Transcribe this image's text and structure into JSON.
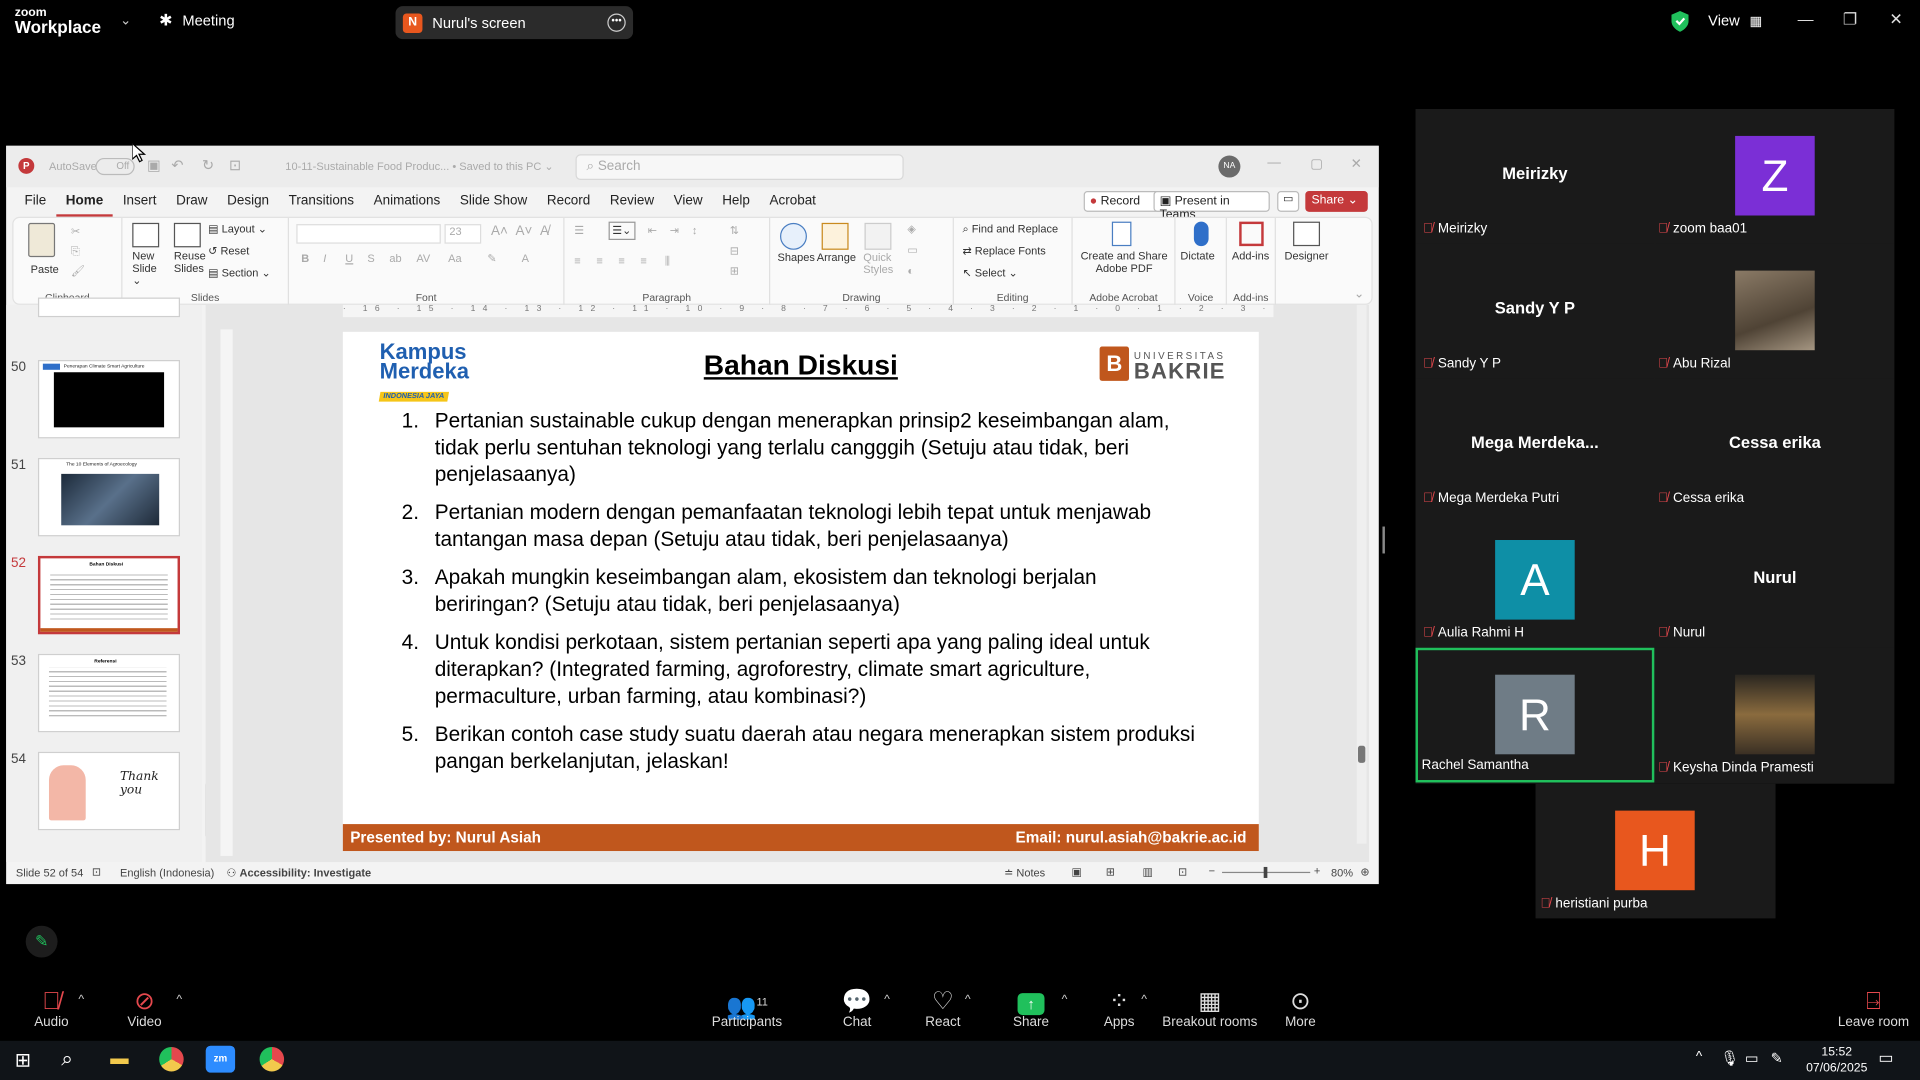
{
  "zoom": {
    "logo_line1": "zoom",
    "logo_line2": "Workplace",
    "meeting_label": "Meeting",
    "share_initial": "N",
    "share_title": "Nurul's screen",
    "view_label": "View"
  },
  "ppt": {
    "autosave": "AutoSave",
    "autosave_state": "Off",
    "filename": "10-11-Sustainable Food Produc... • Saved to this PC ⌄",
    "search_placeholder": "Search",
    "user_initials": "NA",
    "menu": [
      "File",
      "Home",
      "Insert",
      "Draw",
      "Design",
      "Transitions",
      "Animations",
      "Slide Show",
      "Record",
      "Review",
      "View",
      "Help",
      "Acrobat"
    ],
    "record_btn": "Record",
    "present_btn": "Present in Teams",
    "share_btn": "Share",
    "ribbon": {
      "paste": "Paste",
      "clipboard": "Clipboard",
      "new_slide": "New Slide ⌄",
      "reuse_slides": "Reuse Slides",
      "layout": "Layout ⌄",
      "reset": "Reset",
      "section": "Section ⌄",
      "slides": "Slides",
      "font": "Font",
      "font_size": "23",
      "paragraph": "Paragraph",
      "shapes": "Shapes",
      "arrange": "Arrange",
      "quick_styles": "Quick Styles",
      "drawing": "Drawing",
      "find_replace": "Find and Replace",
      "replace_fonts": "Replace Fonts",
      "select": "Select ⌄",
      "editing": "Editing",
      "create_share": "Create and Share Adobe PDF",
      "adobe_acrobat": "Adobe Acrobat",
      "dictate": "Dictate",
      "voice": "Voice",
      "addins": "Add-ins",
      "addins_group": "Add-ins",
      "designer": "Designer"
    },
    "thumb_numbers": [
      "50",
      "51",
      "52",
      "53",
      "54"
    ],
    "thumb_captions": [
      "Penerapan Climate Smart Agriculture",
      "The 10 Elements of Agroecology",
      "Bahan Diskusi",
      "Referensi",
      "Thank you"
    ],
    "status_slide": "Slide 52 of 54",
    "status_lang": "English (Indonesia)",
    "status_access": "Accessibility: Investigate",
    "status_notes": "Notes",
    "status_zoom": "80%"
  },
  "slide": {
    "logo_left_1": "Kampus",
    "logo_left_2": "Merdeka",
    "logo_left_3": "INDONESIA JAYA",
    "title": "Bahan Diskusi",
    "logo_right_1": "UNIVERSITAS",
    "logo_right_2": "BAKRIE",
    "items": [
      {
        "n": "1.",
        "t": "Pertanian sustainable cukup dengan menerapkan prinsip2 keseimbangan alam, tidak perlu sentuhan teknologi yang terlalu cangggih (Setuju atau tidak, beri penjelasaanya)"
      },
      {
        "n": "2.",
        "t": "Pertanian modern dengan pemanfaatan teknologi lebih tepat untuk menjawab tantangan masa depan (Setuju atau tidak, beri penjelasaanya)"
      },
      {
        "n": "3.",
        "t": "Apakah mungkin keseimbangan alam, ekosistem dan teknologi berjalan beriringan? (Setuju atau tidak, beri penjelasaanya)"
      },
      {
        "n": "4.",
        "t": "Untuk kondisi perkotaan, sistem pertanian seperti apa yang paling ideal untuk diterapkan? (Integrated farming, agroforestry, climate smart agriculture, permaculture, urban farming, atau kombinasi?)"
      },
      {
        "n": "5.",
        "t": "Berikan contoh case study suatu daerah atau negara menerapkan sistem produksi pangan berkelanjutan, jelaskan!"
      }
    ],
    "footer_left": "Presented by: Nurul Asiah",
    "footer_right": "Email: nurul.asiah@bakrie.ac.id"
  },
  "participants": [
    {
      "big": "Meirizky",
      "name": "Meirizky",
      "avatar": "",
      "color": ""
    },
    {
      "big": "",
      "name": "zoom baa01",
      "avatar": "Z",
      "color": "#7b2fd6"
    },
    {
      "big": "Sandy Y P",
      "name": "Sandy Y P",
      "avatar": "",
      "color": ""
    },
    {
      "big": "",
      "name": "Abu Rizal",
      "avatar": "photo",
      "color": "#6b5a48"
    },
    {
      "big": "Mega  Merdeka...",
      "name": "Mega Merdeka Putri",
      "avatar": "",
      "color": ""
    },
    {
      "big": "Cessa erika",
      "name": "Cessa erika",
      "avatar": "",
      "color": ""
    },
    {
      "big": "",
      "name": "Aulia Rahmi H",
      "avatar": "A",
      "color": "#0e8fa6"
    },
    {
      "big": "Nurul",
      "name": "Nurul",
      "avatar": "",
      "color": ""
    },
    {
      "big": "",
      "name": "Rachel Samantha",
      "avatar": "R",
      "color": "#6f7c86"
    },
    {
      "big": "",
      "name": "Keysha Dinda Pramesti",
      "avatar": "photo",
      "color": "#5a4a30"
    },
    {
      "big": "",
      "name": "heristiani purba",
      "avatar": "H",
      "color": "#e8571e"
    }
  ],
  "bottom_bar": {
    "audio": "Audio",
    "video": "Video",
    "participants": "Participants",
    "participants_count": "11",
    "chat": "Chat",
    "react": "React",
    "share": "Share",
    "apps": "Apps",
    "breakout": "Breakout rooms",
    "more": "More",
    "leave": "Leave room"
  },
  "taskbar": {
    "time": "15:52",
    "date": "07/06/2025"
  }
}
